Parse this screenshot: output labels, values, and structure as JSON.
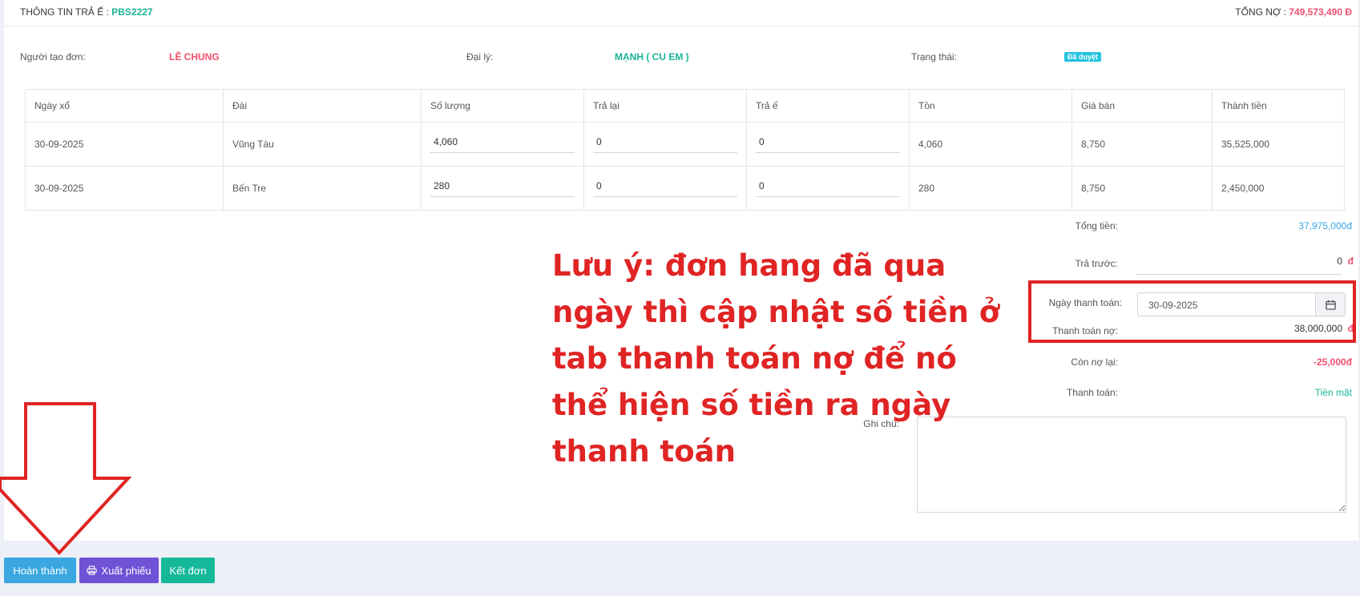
{
  "header": {
    "title_prefix": "THÔNG TIN TRẢ Ế : ",
    "code": "PBS2227",
    "debt_prefix": "TỔNG NỢ : ",
    "debt_value": "749,573,490 đ"
  },
  "info": {
    "creator_label": "Người tạo đơn:",
    "creator_value": "LÊ CHUNG",
    "agent_label": "Đại lý:",
    "agent_value": "MẠNH ( CU EM )",
    "status_label": "Trạng thái:",
    "status_value": "Đã duyệt"
  },
  "table": {
    "headers": [
      "Ngày xổ",
      "Đài",
      "Số lượng",
      "Trả lại",
      "Trả ế",
      "Tồn",
      "Giá bán",
      "Thành tiền"
    ],
    "rows": [
      {
        "date": "30-09-2025",
        "station": "Vũng Tàu",
        "qty": "4,060",
        "returned": "0",
        "unsold": "0",
        "stock": "4,060",
        "price": "8,750",
        "amount": "35,525,000"
      },
      {
        "date": "30-09-2025",
        "station": "Bến Tre",
        "qty": "280",
        "returned": "0",
        "unsold": "0",
        "stock": "280",
        "price": "8,750",
        "amount": "2,450,000"
      }
    ]
  },
  "summary": {
    "total_label": "Tổng tiền:",
    "total_value": "37,975,000đ",
    "prepay_label": "Trả trước:",
    "prepay_value": "0",
    "prepay_unit": "đ",
    "paydate_label": "Ngày thanh toán:",
    "paydate_value": "30-09-2025",
    "debtpay_label": "Thanh toán nợ:",
    "debtpay_value": "38,000,000",
    "debtpay_unit": "đ",
    "remain_label": "Còn nợ lại:",
    "remain_value": "-25,000đ",
    "method_label": "Thanh toán:",
    "method_value": "Tiền mặt",
    "note_label": "Ghi chú:"
  },
  "annotation": {
    "line1": "Lưu ý: đơn hang đã qua",
    "line2": "ngày thì cập nhật số tiền ở",
    "line3": "tab thanh toán nợ để nó",
    "line4": "thể hiện số tiền ra ngày",
    "line5": "thanh toán"
  },
  "buttons": {
    "complete": "Hoàn thành",
    "export": "Xuất phiếu",
    "close": "Kết đơn"
  },
  "colors": {
    "green": "#1bb395",
    "red": "#f0506e",
    "blue_button": "#3aa7e0",
    "purple_button": "#6f52d6",
    "green_button": "#16b89a",
    "annotation_red": "#e02424"
  }
}
